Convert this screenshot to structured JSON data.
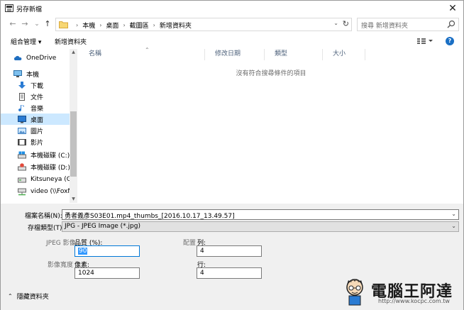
{
  "window": {
    "title": "另存新檔",
    "close_glyph": "✕"
  },
  "nav": {
    "back_glyph": "←",
    "forward_glyph": "→",
    "recent_glyph": "⌄",
    "up_glyph": "↑",
    "breadcrumbs": [
      "本機",
      "桌面",
      "截圖區",
      "新增資料夾"
    ],
    "address_dropdown_glyph": "⌄",
    "refresh_glyph": "↻",
    "search_placeholder": "搜尋 新增資料夾"
  },
  "toolbar": {
    "organize_label": "組合管理 ▾",
    "new_folder_label": "新增資料夾",
    "help_glyph": "?"
  },
  "sidebar": {
    "items": [
      {
        "label": "OneDrive",
        "icon": "cloud-icon"
      },
      {
        "label": "本機",
        "icon": "computer-icon"
      },
      {
        "label": "下載",
        "icon": "download-icon"
      },
      {
        "label": "文件",
        "icon": "document-icon"
      },
      {
        "label": "音樂",
        "icon": "music-icon"
      },
      {
        "label": "桌面",
        "icon": "desktop-icon",
        "selected": true
      },
      {
        "label": "圖片",
        "icon": "pictures-icon"
      },
      {
        "label": "影片",
        "icon": "video-icon"
      },
      {
        "label": "本機磁碟 (C:)",
        "icon": "drive-c-icon"
      },
      {
        "label": "本機磁碟 (D:)",
        "icon": "drive-d-icon"
      },
      {
        "label": "Kitsuneya (G:)",
        "icon": "drive-g-icon"
      },
      {
        "label": "video (\\\\FoxNa",
        "icon": "network-drive-icon"
      }
    ]
  },
  "filelist": {
    "columns": [
      "名稱",
      "修改日期",
      "類型",
      "大小"
    ],
    "sort_glyph": "⌃",
    "empty_message": "沒有符合搜尋條件的項目"
  },
  "form": {
    "filename_label": "檔案名稱(N):",
    "filename_value": "勇者義彥S03E01.mp4_thumbs_[2016.10.17_13.49.57]",
    "filetype_label": "存檔類型(T):",
    "filetype_value": "JPG - JPEG Image (*.jpg)",
    "dropdown_glyph": "⌄",
    "jpeg_label": "JPEG 影像",
    "quality_label": "品質 (%):",
    "quality_value": "90",
    "layout_label": "配置",
    "columns_label": "列:",
    "columns_value": "4",
    "width_label": "影像寬度",
    "pixels_label": "像素:",
    "pixels_value": "1024",
    "rows_label": "行:",
    "rows_value": "4",
    "hide_folders_glyph": "⌃",
    "hide_folders_label": "隱藏資料夾"
  },
  "watermark": {
    "brand": "電腦王阿達",
    "url": "http://www.kocpc.com.tw"
  }
}
